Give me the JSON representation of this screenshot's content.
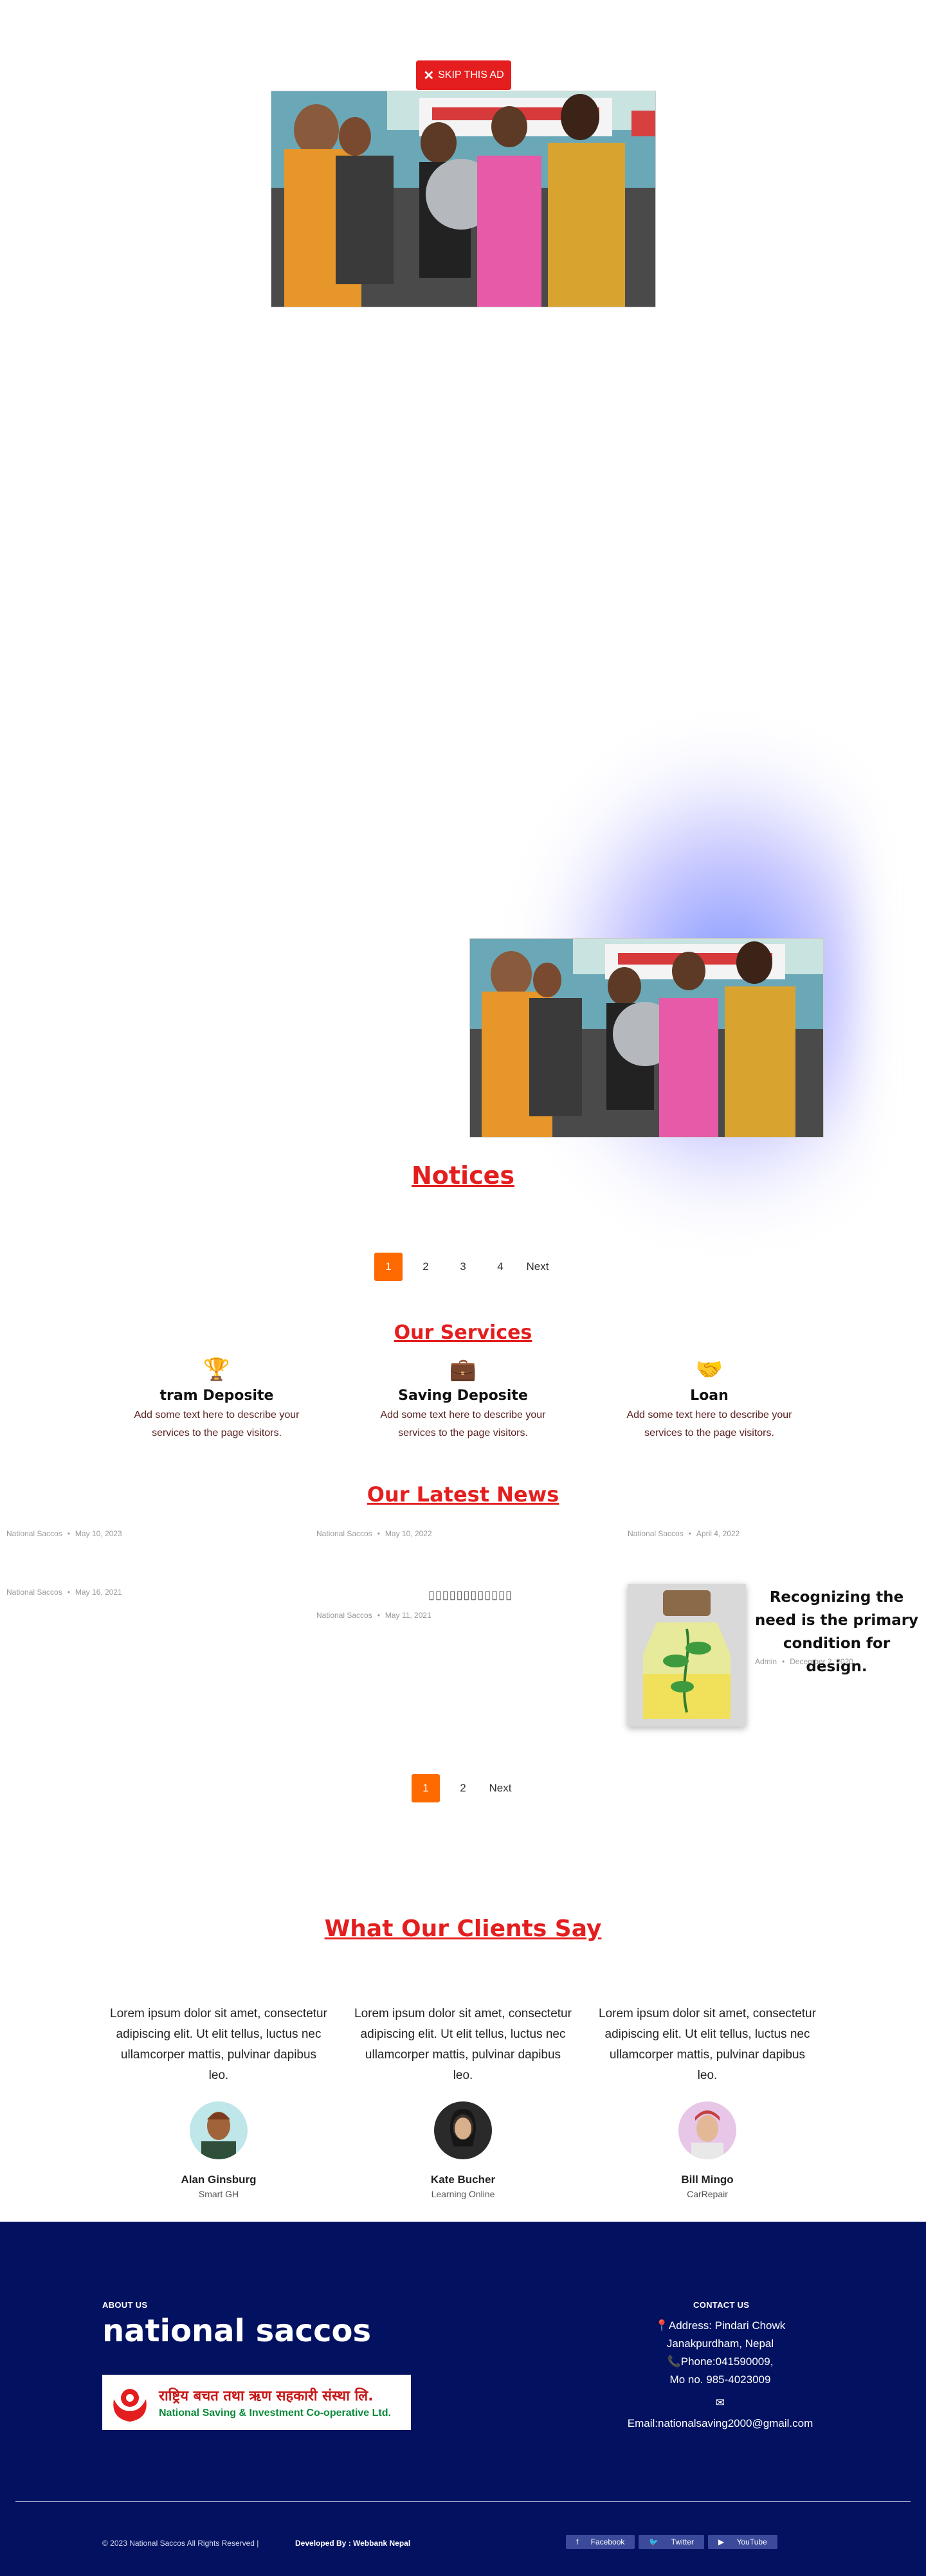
{
  "ad": {
    "skip_label": "SKIP THIS AD"
  },
  "notices": {
    "title": "Notices",
    "pages": [
      "1",
      "2",
      "3",
      "4"
    ],
    "next_label": "Next"
  },
  "services": {
    "title": "Our Services",
    "items": [
      {
        "icon": "trophy-icon",
        "title": "tram Deposite",
        "text": "Add some text here to describe your services to the page visitors."
      },
      {
        "icon": "briefcase-icon",
        "title": "Saving Deposite",
        "text": "Add some text here to describe your services to the page visitors."
      },
      {
        "icon": "handshake-icon",
        "title": "Loan",
        "text": "Add some text here to describe your services to the page visitors."
      }
    ]
  },
  "news": {
    "title": "Our Latest News",
    "posts": [
      {
        "author": "National Saccos",
        "date": "May 10, 2023"
      },
      {
        "author": "National Saccos",
        "date": "May 10, 2022"
      },
      {
        "author": "National Saccos",
        "date": "April 4, 2022"
      },
      {
        "author": "National Saccos",
        "date": "May 16, 2021"
      },
      {
        "author": "National Saccos",
        "date": "May 11, 2021",
        "title": "▯▯▯▯▯▯▯▯▯▯▯▯"
      },
      {
        "author": "Admin",
        "date": "December 2, 2020",
        "title": "Recognizing the need is the primary condition for design."
      }
    ],
    "pages": [
      "1",
      "2"
    ],
    "next_label": "Next"
  },
  "testimonials": {
    "title": "What Our Clients Say",
    "items": [
      {
        "quote": "Lorem ipsum dolor sit amet, consectetur adipiscing elit. Ut elit tellus, luctus nec ullamcorper mattis, pulvinar dapibus leo.",
        "name": "Alan Ginsburg",
        "role": "Smart GH"
      },
      {
        "quote": "Lorem ipsum dolor sit amet, consectetur adipiscing elit. Ut elit tellus, luctus nec ullamcorper mattis, pulvinar dapibus leo.",
        "name": "Kate Bucher",
        "role": "Learning Online"
      },
      {
        "quote": "Lorem ipsum dolor sit amet, consectetur adipiscing elit. Ut elit tellus, luctus nec ullamcorper mattis, pulvinar dapibus leo.",
        "name": "Bill Mingo",
        "role": "CarRepair"
      }
    ]
  },
  "footer": {
    "about_label": "ABOUT US",
    "brand": "national saccos",
    "logo_nepali": "राष्ट्रिय बचत तथा ऋण सहकारी संस्था लि.",
    "logo_english": "National Saving & Investment Co-operative Ltd.",
    "contact_label": "CONTACT US",
    "address": "Address: Pindari Chowk",
    "address2": "Janakpurdham, Nepal",
    "phone": "Phone:041590009,",
    "mobile": "Mo no. 985-4023009",
    "email": "Email:nationalsaving2000@gmail.com",
    "copyright": "© 2023 National Saccos All Rights Reserved |",
    "developer": "Developed By : Webbank Nepal",
    "social": [
      "Facebook",
      "Twitter",
      "YouTube"
    ]
  },
  "colors": {
    "accent_red": "#e41e1e",
    "orange": "#ff6a00",
    "footer_navy": "#021261"
  }
}
